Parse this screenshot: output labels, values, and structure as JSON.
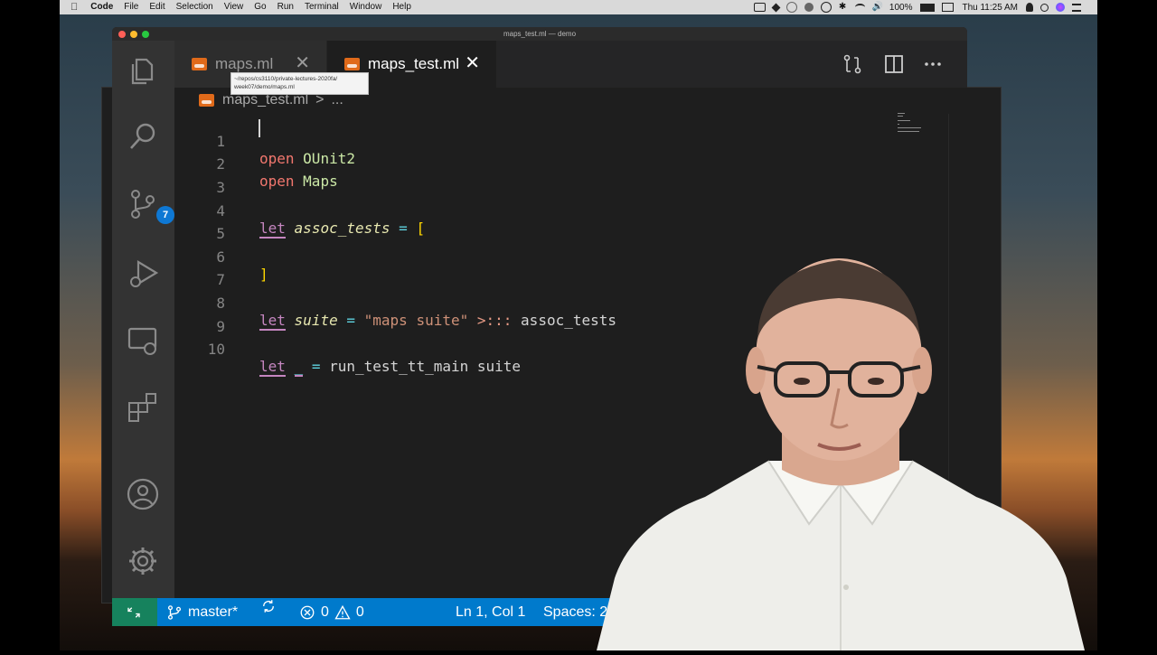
{
  "menubar": {
    "items": [
      "Code",
      "File",
      "Edit",
      "Selection",
      "View",
      "Go",
      "Run",
      "Terminal",
      "Window",
      "Help"
    ],
    "battery": "100%",
    "clock": "Thu 11:25 AM"
  },
  "window": {
    "title": "maps_test.ml — demo"
  },
  "activity": {
    "scm_badge": "7"
  },
  "tabs": [
    {
      "label": "maps.ml",
      "close": "✕"
    },
    {
      "label": "maps_test.ml",
      "close": "✕"
    }
  ],
  "tooltip": {
    "line1": "~/repos/cs3110/private-lectures-2020fa/",
    "line2": "week07/demo/maps.ml"
  },
  "breadcrumb": {
    "file": "maps_test.ml",
    "sep": ">",
    "rest": "..."
  },
  "editor": {
    "line_numbers": [
      "1",
      "2",
      "3",
      "4",
      "5",
      "6",
      "7",
      "8",
      "9",
      "10"
    ],
    "l1": {
      "kw": "open",
      "mod": "OUnit2"
    },
    "l2": {
      "kw": "open",
      "mod": "Maps"
    },
    "l4": {
      "kw": "let",
      "ident": "assoc_tests",
      "eq": "=",
      "brk": "["
    },
    "l6": {
      "brk": "]"
    },
    "l8": {
      "kw": "let",
      "ident": "suite",
      "eq": "=",
      "str": "\"maps suite\"",
      "op": ">:::",
      "rest": "assoc_tests"
    },
    "l10": {
      "kw": "let",
      "ident": "_",
      "eq": "=",
      "rest": "run_test_tt_main suite"
    }
  },
  "statusbar": {
    "branch": "master*",
    "errors": "0",
    "warnings": "0",
    "position": "Ln 1, Col 1",
    "spaces": "Spaces: 2"
  },
  "colors": {
    "statusbar": "#007acc",
    "remote": "#16825d",
    "badge": "#0e78d4"
  }
}
